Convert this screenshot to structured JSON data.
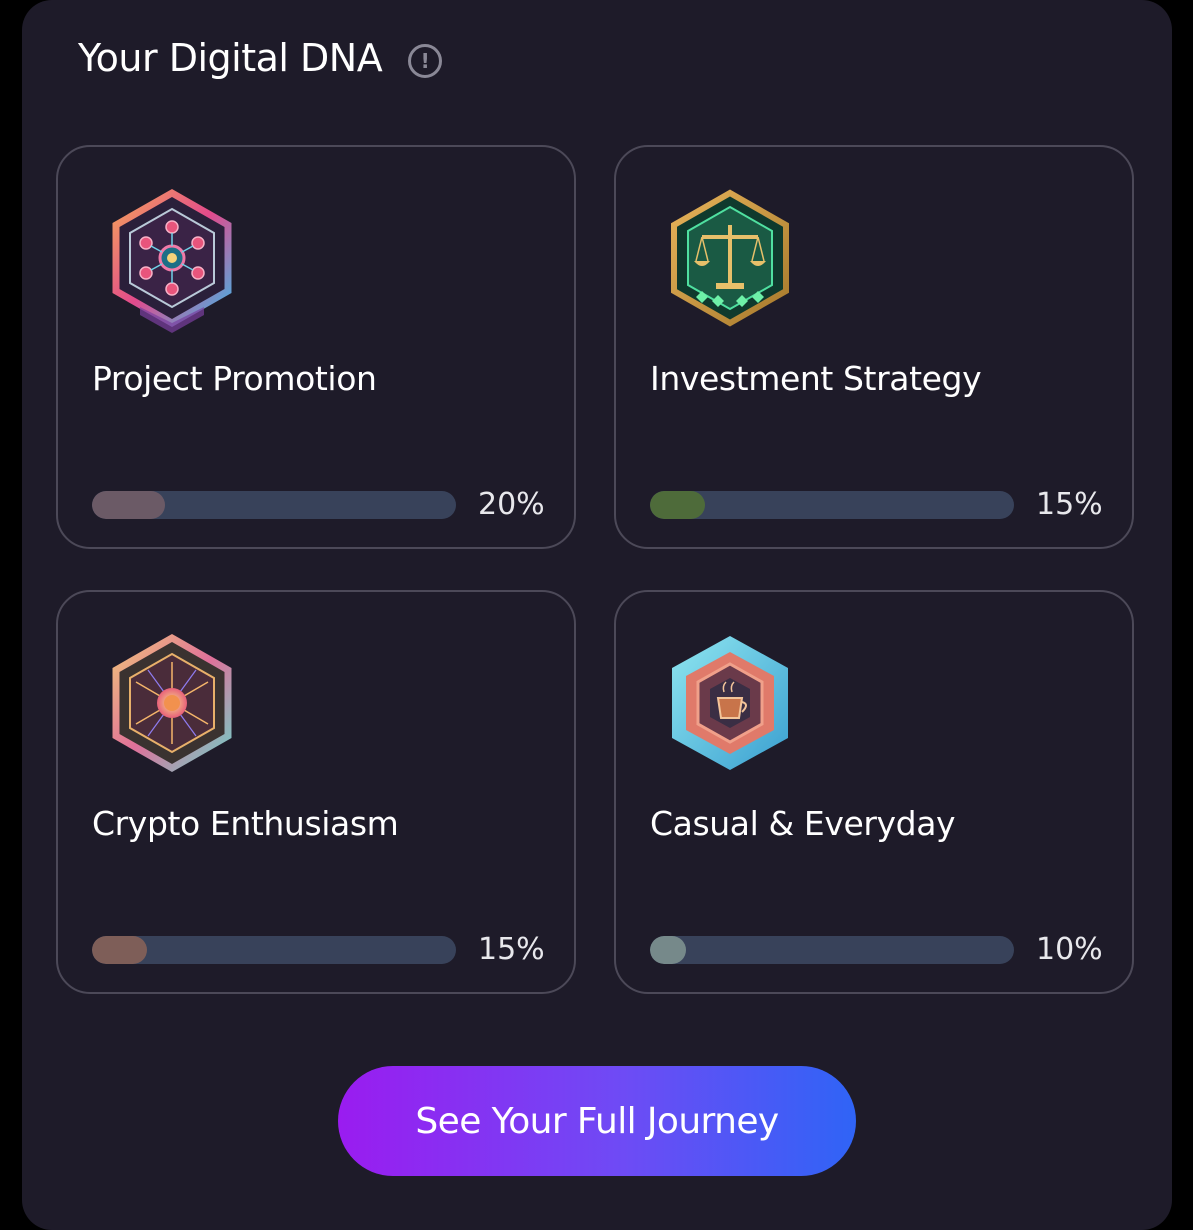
{
  "header": {
    "title": "Your Digital DNA",
    "info_glyph": "!"
  },
  "cards": [
    {
      "label": "Project Promotion",
      "percent_text": "20%",
      "percent": 20,
      "bar_color": "#6b5a66",
      "icon": "network-hexagon-badge-icon"
    },
    {
      "label": "Investment Strategy",
      "percent_text": "15%",
      "percent": 15,
      "bar_color": "#4e6b3a",
      "icon": "balance-scale-hexagon-badge-icon"
    },
    {
      "label": "Crypto Enthusiasm",
      "percent_text": "15%",
      "percent": 15,
      "bar_color": "#7e5e58",
      "icon": "starburst-hexagon-badge-icon"
    },
    {
      "label": "Casual & Everyday",
      "percent_text": "10%",
      "percent": 10,
      "bar_color": "#76898a",
      "icon": "coffee-cup-hexagon-badge-icon"
    }
  ],
  "cta": {
    "label": "See Your Full Journey"
  },
  "colors": {
    "panel_bg": "#1e1b29",
    "track": "#38425a",
    "card_border": "#4c4958",
    "cta_gradient_start": "#9a1cf0",
    "cta_gradient_end": "#2f64f6"
  }
}
